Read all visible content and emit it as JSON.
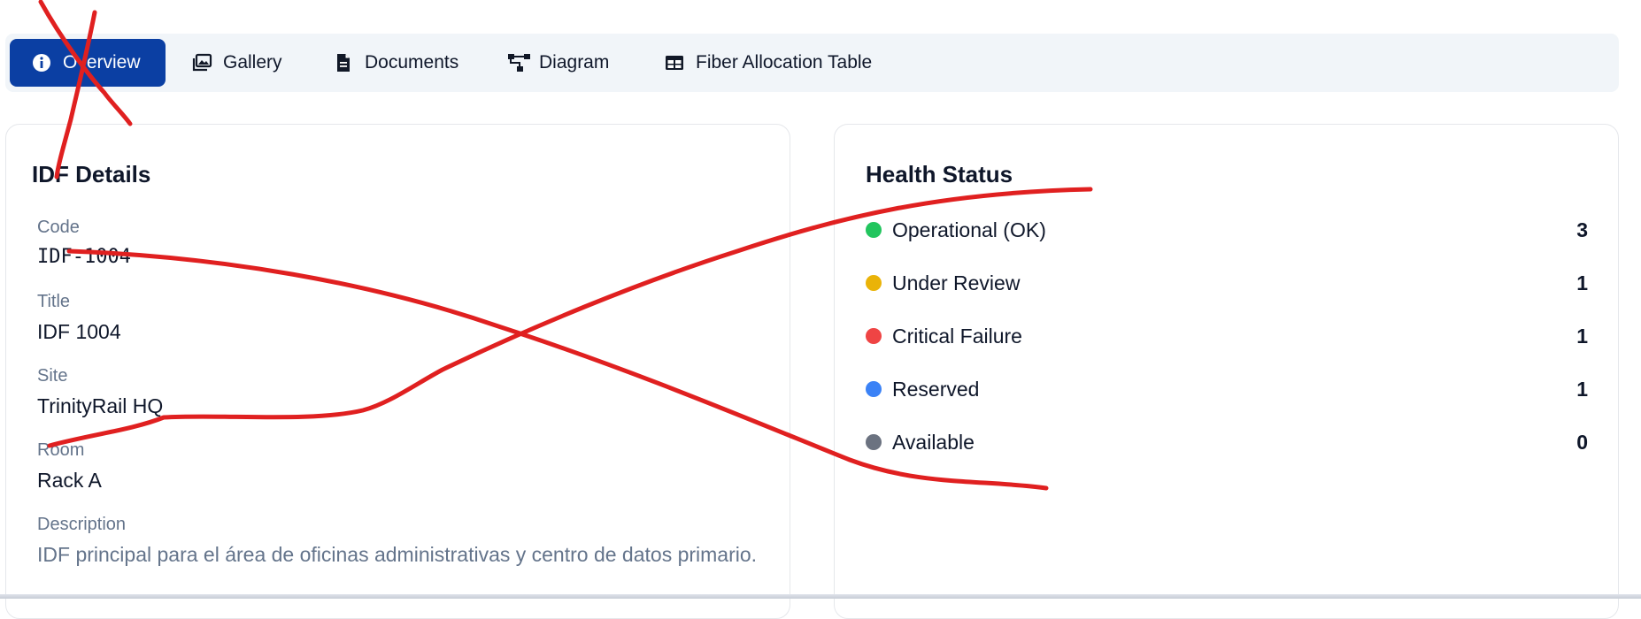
{
  "tabs": [
    {
      "label": "Overview",
      "icon": "info-icon",
      "active": true
    },
    {
      "label": "Gallery",
      "icon": "gallery-icon",
      "active": false
    },
    {
      "label": "Documents",
      "icon": "document-icon",
      "active": false
    },
    {
      "label": "Diagram",
      "icon": "diagram-icon",
      "active": false
    },
    {
      "label": "Fiber Allocation Table",
      "icon": "table-icon",
      "active": false
    }
  ],
  "details": {
    "title": "IDF Details",
    "fields": [
      {
        "label": "Code",
        "value": "IDF-1004"
      },
      {
        "label": "Title",
        "value": "IDF 1004"
      },
      {
        "label": "Site",
        "value": "TrinityRail HQ"
      },
      {
        "label": "Room",
        "value": "Rack A"
      },
      {
        "label": "Description",
        "value": "IDF principal para el área de oficinas administrativas y centro de datos primario."
      }
    ]
  },
  "health": {
    "title": "Health Status",
    "items": [
      {
        "label": "Operational (OK)",
        "count": "3",
        "color": "#22c55e"
      },
      {
        "label": "Under Review",
        "count": "1",
        "color": "#eab308"
      },
      {
        "label": "Critical Failure",
        "count": "1",
        "color": "#ef4444"
      },
      {
        "label": "Reserved",
        "count": "1",
        "color": "#3b82f6"
      },
      {
        "label": "Available",
        "count": "0",
        "color": "#6b7280"
      }
    ]
  },
  "annotation_color": "#e02020"
}
